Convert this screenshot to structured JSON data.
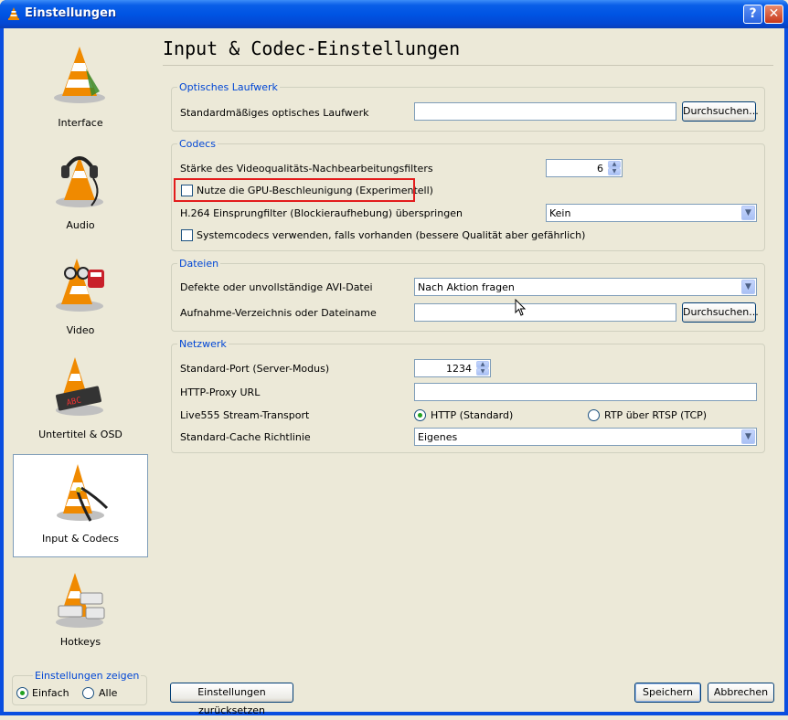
{
  "window": {
    "title": "Einstellungen",
    "help_label": "?",
    "close_label": "✕"
  },
  "sidebar": {
    "items": [
      {
        "label": "Interface",
        "icon": "vlc-cone-icon"
      },
      {
        "label": "Audio",
        "icon": "headphones-cone-icon"
      },
      {
        "label": "Video",
        "icon": "glasses-cone-icon"
      },
      {
        "label": "Untertitel & OSD",
        "icon": "subtitle-cone-icon"
      },
      {
        "label": "Input & Codecs",
        "icon": "cable-cone-icon"
      },
      {
        "label": "Hotkeys",
        "icon": "keyboard-cone-icon"
      }
    ],
    "show_settings": {
      "legend": "Einstellungen zeigen",
      "simple": "Einfach",
      "all": "Alle"
    }
  },
  "page": {
    "title": "Input & Codec-Einstellungen"
  },
  "optical": {
    "legend": "Optisches Laufwerk",
    "drive_label": "Standardmäßiges optisches Laufwerk",
    "drive_value": "",
    "browse": "Durchsuchen..."
  },
  "codecs": {
    "legend": "Codecs",
    "pp_label": "Stärke des Videoqualitäts-Nachbearbeitungsfilters",
    "pp_value": "6",
    "gpu_label": "Nutze die GPU-Beschleunigung (Experimentell)",
    "h264_label": "H.264 Einsprungfilter (Blockieraufhebung) überspringen",
    "h264_value": "Kein",
    "syscodecs_label": "Systemcodecs verwenden, falls vorhanden (bessere Qualität aber gefährlich)"
  },
  "files": {
    "legend": "Dateien",
    "avi_label": "Defekte oder unvollständige AVI-Datei",
    "avi_value": "Nach Aktion fragen",
    "record_label": "Aufnahme-Verzeichnis oder Dateiname",
    "record_value": "",
    "browse": "Durchsuchen..."
  },
  "network": {
    "legend": "Netzwerk",
    "port_label": "Standard-Port (Server-Modus)",
    "port_value": "1234",
    "proxy_label": "HTTP-Proxy URL",
    "proxy_value": "",
    "live555_label": "Live555 Stream-Transport",
    "http_option": "HTTP (Standard)",
    "rtp_option": "RTP über RTSP (TCP)",
    "cache_label": "Standard-Cache Richtlinie",
    "cache_value": "Eigenes"
  },
  "footer": {
    "reset": "Einstellungen zurücksetzen",
    "save": "Speichern",
    "cancel": "Abbrechen"
  },
  "colors": {
    "accent": "#0046d5",
    "highlight": "#e31c1c",
    "titlebar": "#0054e3"
  }
}
